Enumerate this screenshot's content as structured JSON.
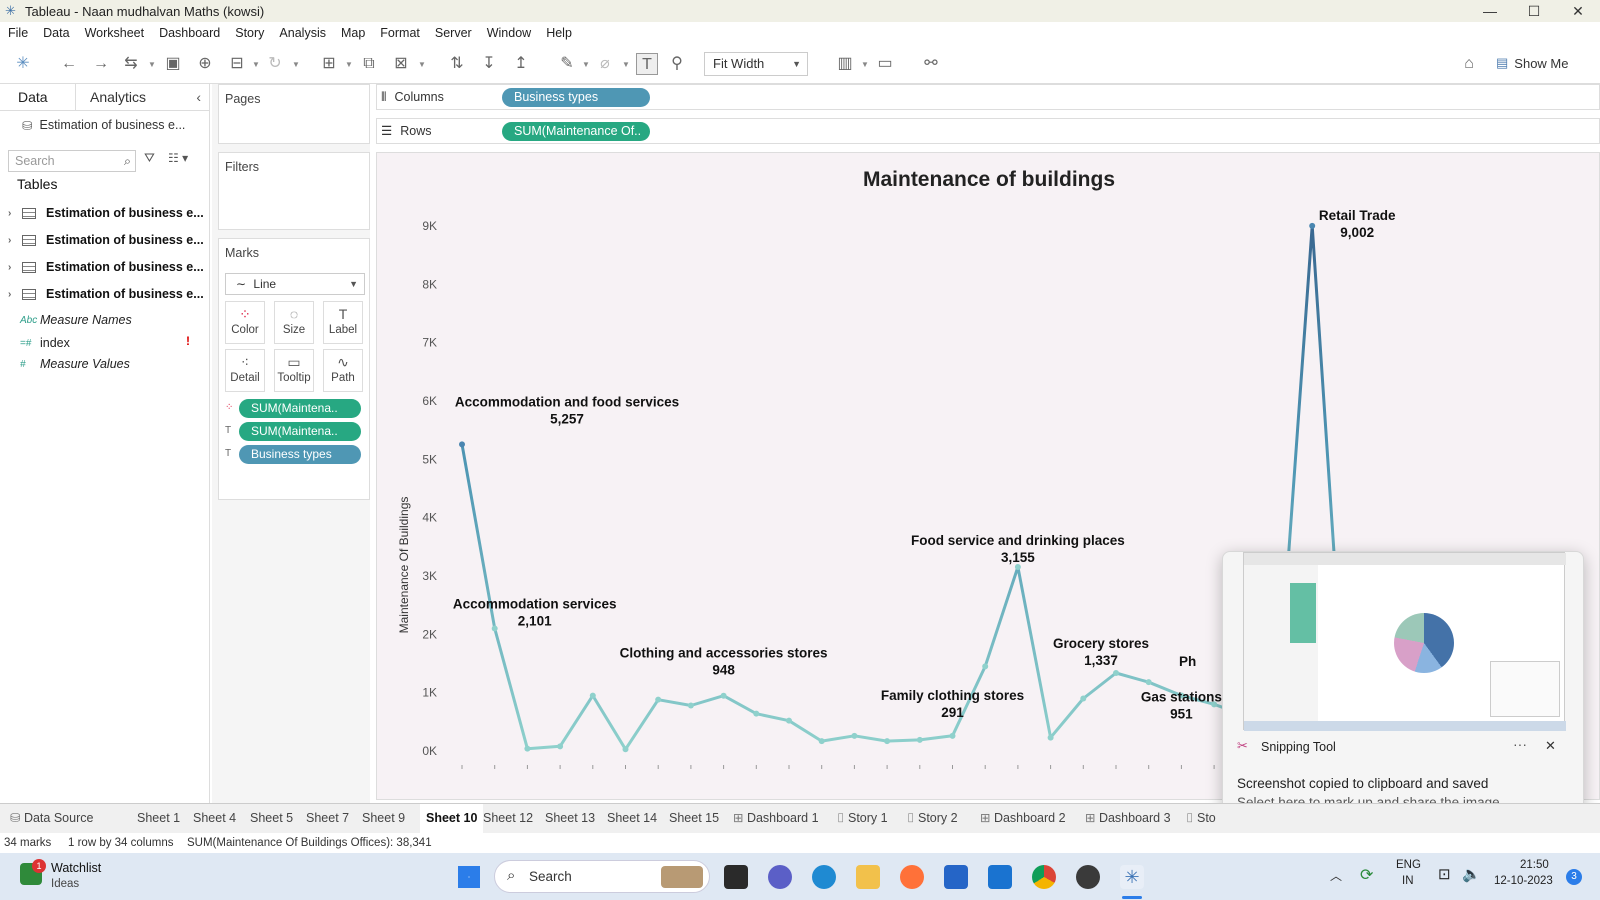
{
  "window": {
    "title": "Tableau - Naan mudhalvan Maths (kowsi)",
    "controls": [
      "—",
      "☐",
      "✕"
    ]
  },
  "menu": [
    "File",
    "Data",
    "Worksheet",
    "Dashboard",
    "Story",
    "Analysis",
    "Map",
    "Format",
    "Server",
    "Window",
    "Help"
  ],
  "toolbar": {
    "fit": "Fit Width",
    "show_me": "Show Me"
  },
  "data_pane": {
    "tabs": [
      "Data",
      "Analytics"
    ],
    "datasource": "Estimation of business e...",
    "search_placeholder": "Search",
    "tables_heading": "Tables",
    "tables": [
      "Estimation of business e...",
      "Estimation of business e...",
      "Estimation of business e...",
      "Estimation of business e..."
    ],
    "fields": [
      {
        "icon": "Abc",
        "name": "Measure Names"
      },
      {
        "icon": "=#",
        "name": "index"
      },
      {
        "icon": "#",
        "name": "Measure Values"
      }
    ],
    "index_warning": "!"
  },
  "shelves": {
    "pages": "Pages",
    "filters": "Filters",
    "marks": "Marks",
    "mark_type": "Line",
    "mark_buttons": [
      "Color",
      "Size",
      "Label",
      "Detail",
      "Tooltip",
      "Path"
    ],
    "mark_pills": [
      "SUM(Maintena..",
      "SUM(Maintena..",
      "Business types"
    ],
    "columns_label": "Columns",
    "columns_pill": "Business types",
    "rows_label": "Rows",
    "rows_pill": "SUM(Maintenance Of.."
  },
  "chart_data": {
    "type": "line",
    "title": "Maintenance of buildings",
    "ylabel": "Maintenance Of Buildings",
    "xlabel": "",
    "ylim": [
      0,
      9000
    ],
    "yticks": [
      "0K",
      "1K",
      "2K",
      "3K",
      "4K",
      "5K",
      "6K",
      "7K",
      "8K",
      "9K"
    ],
    "values": [
      5257,
      2101,
      40,
      80,
      950,
      30,
      880,
      780,
      948,
      640,
      520,
      170,
      260,
      170,
      190,
      260,
      1450,
      3155,
      230,
      900,
      1337,
      1180,
      951,
      800,
      600,
      1200,
      9002,
      600
    ],
    "annotations": [
      {
        "index": 0,
        "name": "Accommodation and food services",
        "value": "5,257"
      },
      {
        "index": 1,
        "name": "Accommodation services",
        "value": "2,101"
      },
      {
        "index": 8,
        "name": "Clothing and accessories stores",
        "value": "948"
      },
      {
        "index": 15,
        "name": "Family clothing stores",
        "value": "291"
      },
      {
        "index": 17,
        "name": "Food service and drinking places",
        "value": "3,155"
      },
      {
        "index": 20,
        "name": "Grocery stores",
        "value": "1,337"
      },
      {
        "index": 22,
        "name": "Gas stations",
        "value": "951"
      },
      {
        "index": 26,
        "name": "Retail Trade",
        "value": "9,002"
      }
    ],
    "partial_label": "Ph",
    "colors": {
      "low": "#8fd1cc",
      "high": "#3a6891"
    }
  },
  "sheet_tabs": [
    "Data Source",
    "Sheet 1",
    "Sheet 4",
    "Sheet 5",
    "Sheet 7",
    "Sheet 9",
    "Sheet 10",
    "Sheet 12",
    "Sheet 13",
    "Sheet 14",
    "Sheet 15",
    "Dashboard 1",
    "Story 1",
    "Story 2",
    "Dashboard 2",
    "Dashboard 3",
    "Sto"
  ],
  "active_sheet": "Sheet 10",
  "status": {
    "marks": "34 marks",
    "dims": "1 row by 34 columns",
    "sum": "SUM(Maintenance Of Buildings Offices): 38,341"
  },
  "snipping": {
    "app": "Snipping Tool",
    "message": "Screenshot copied to clipboard and saved",
    "sub": "Select here to mark up and share the image",
    "more": "···",
    "close": "✕"
  },
  "taskbar": {
    "watchlist": "Watchlist",
    "watchlist_sub": "Ideas",
    "watch_badge": "1",
    "search": "Search",
    "lang": "ENG",
    "region": "IN",
    "time": "21:50",
    "date": "12-10-2023",
    "notif": "3"
  }
}
